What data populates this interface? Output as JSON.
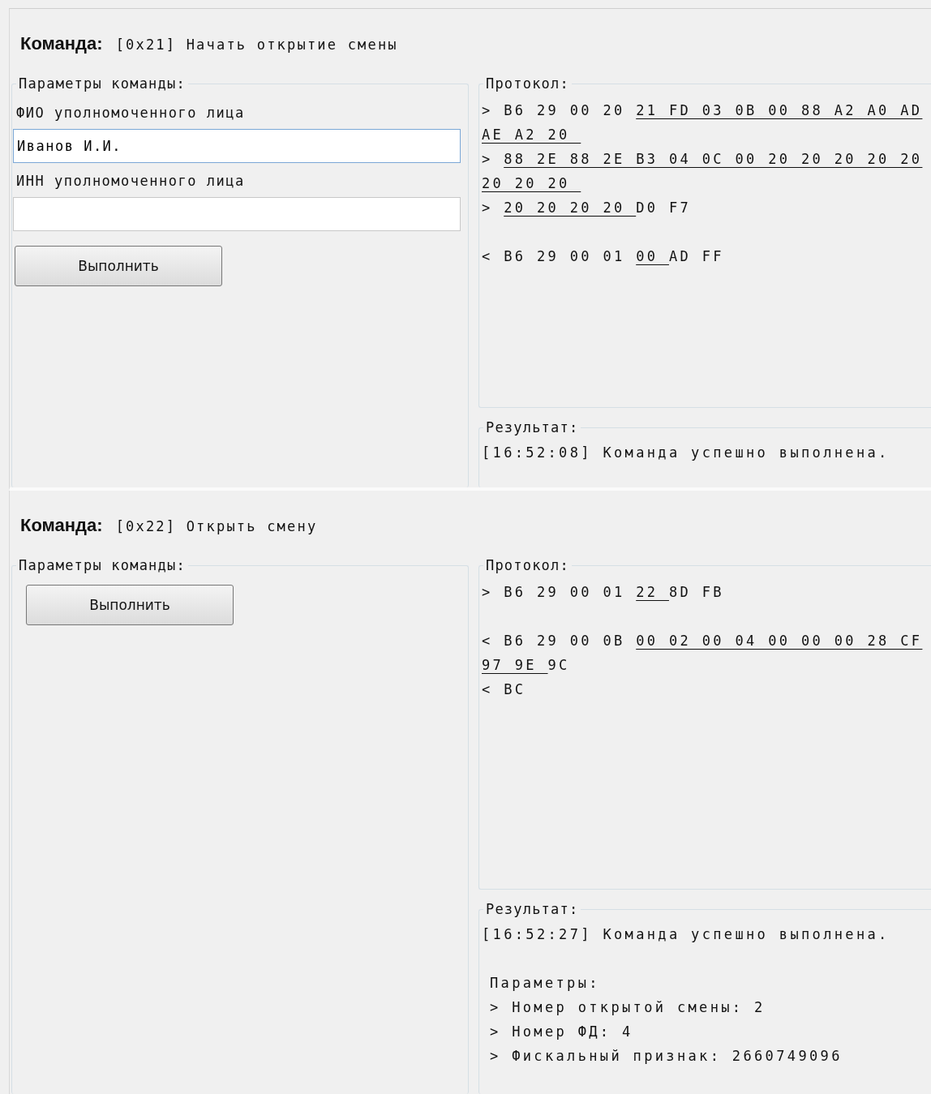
{
  "commands": [
    {
      "label": "Команда:",
      "title": "[0x21] Начать открытие смены",
      "params_title": "Параметры команды:",
      "fields": [
        {
          "label": "ФИО уполномоченного лица",
          "value": "Иванов И.И.",
          "focused": true
        },
        {
          "label": "ИНН уполномоченного лица",
          "focused": false
        }
      ],
      "button": "Выполнить",
      "protocol_title": "Протокол:",
      "protocol_lines": [
        {
          "kind": "text",
          "segments": [
            {
              "text": "> B6 29 00 20 ",
              "underlined": false
            },
            {
              "text": "21 FD 03 0B 00 88 A2 A0 AD",
              "underlined": true
            }
          ]
        },
        {
          "kind": "text",
          "segments": [
            {
              "text": "AE A2 20 ",
              "underlined": true
            }
          ]
        },
        {
          "kind": "text",
          "segments": [
            {
              "text": "> ",
              "underlined": false
            },
            {
              "text": "88 2E 88 2E B3 04 0C 00 20 20 20 20 20",
              "underlined": true
            }
          ]
        },
        {
          "kind": "text",
          "segments": [
            {
              "text": "20 20 20 ",
              "underlined": true
            }
          ]
        },
        {
          "kind": "text",
          "segments": [
            {
              "text": "> ",
              "underlined": false
            },
            {
              "text": "20 20 20 20 ",
              "underlined": true
            },
            {
              "text": "D0 F7",
              "underlined": false
            }
          ]
        },
        {
          "kind": "blank"
        },
        {
          "kind": "text",
          "segments": [
            {
              "text": "< B6 29 00 01 ",
              "underlined": false
            },
            {
              "text": "00 ",
              "underlined": true
            },
            {
              "text": "AD FF",
              "underlined": false
            }
          ]
        }
      ],
      "result_title": "Результат:",
      "result_lines": [
        {
          "kind": "text",
          "text": "[16:52:08] Команда успешно выполнена."
        }
      ]
    },
    {
      "label": "Команда:",
      "title": "[0x22] Открыть смену",
      "params_title": "Параметры команды:",
      "button": "Выполнить",
      "protocol_title": "Протокол:",
      "protocol_lines": [
        {
          "kind": "text",
          "segments": [
            {
              "text": "> B6 29 00 01 ",
              "underlined": false
            },
            {
              "text": "22 ",
              "underlined": true
            },
            {
              "text": "8D FB",
              "underlined": false
            }
          ]
        },
        {
          "kind": "blank"
        },
        {
          "kind": "text",
          "segments": [
            {
              "text": "< B6 29 00 0B ",
              "underlined": false
            },
            {
              "text": "00 02 00 04 00 00 00 28 CF",
              "underlined": true
            }
          ]
        },
        {
          "kind": "text",
          "segments": [
            {
              "text": "97 9E ",
              "underlined": true
            },
            {
              "text": "9C",
              "underlined": false
            }
          ]
        },
        {
          "kind": "text",
          "segments": [
            {
              "text": "< BC",
              "underlined": false
            }
          ]
        }
      ],
      "result_title": "Результат:",
      "result_lines": [
        {
          "kind": "text",
          "text": "[16:52:27] Команда успешно выполнена."
        },
        {
          "kind": "blank"
        },
        {
          "kind": "indented",
          "text": "Параметры:"
        },
        {
          "kind": "indented",
          "text": "> Номер открытой смены: 2"
        },
        {
          "kind": "indented",
          "text": "> Номер ФД: 4"
        },
        {
          "kind": "indented",
          "text": "> Фискальный признак: 2660749096"
        }
      ]
    }
  ]
}
